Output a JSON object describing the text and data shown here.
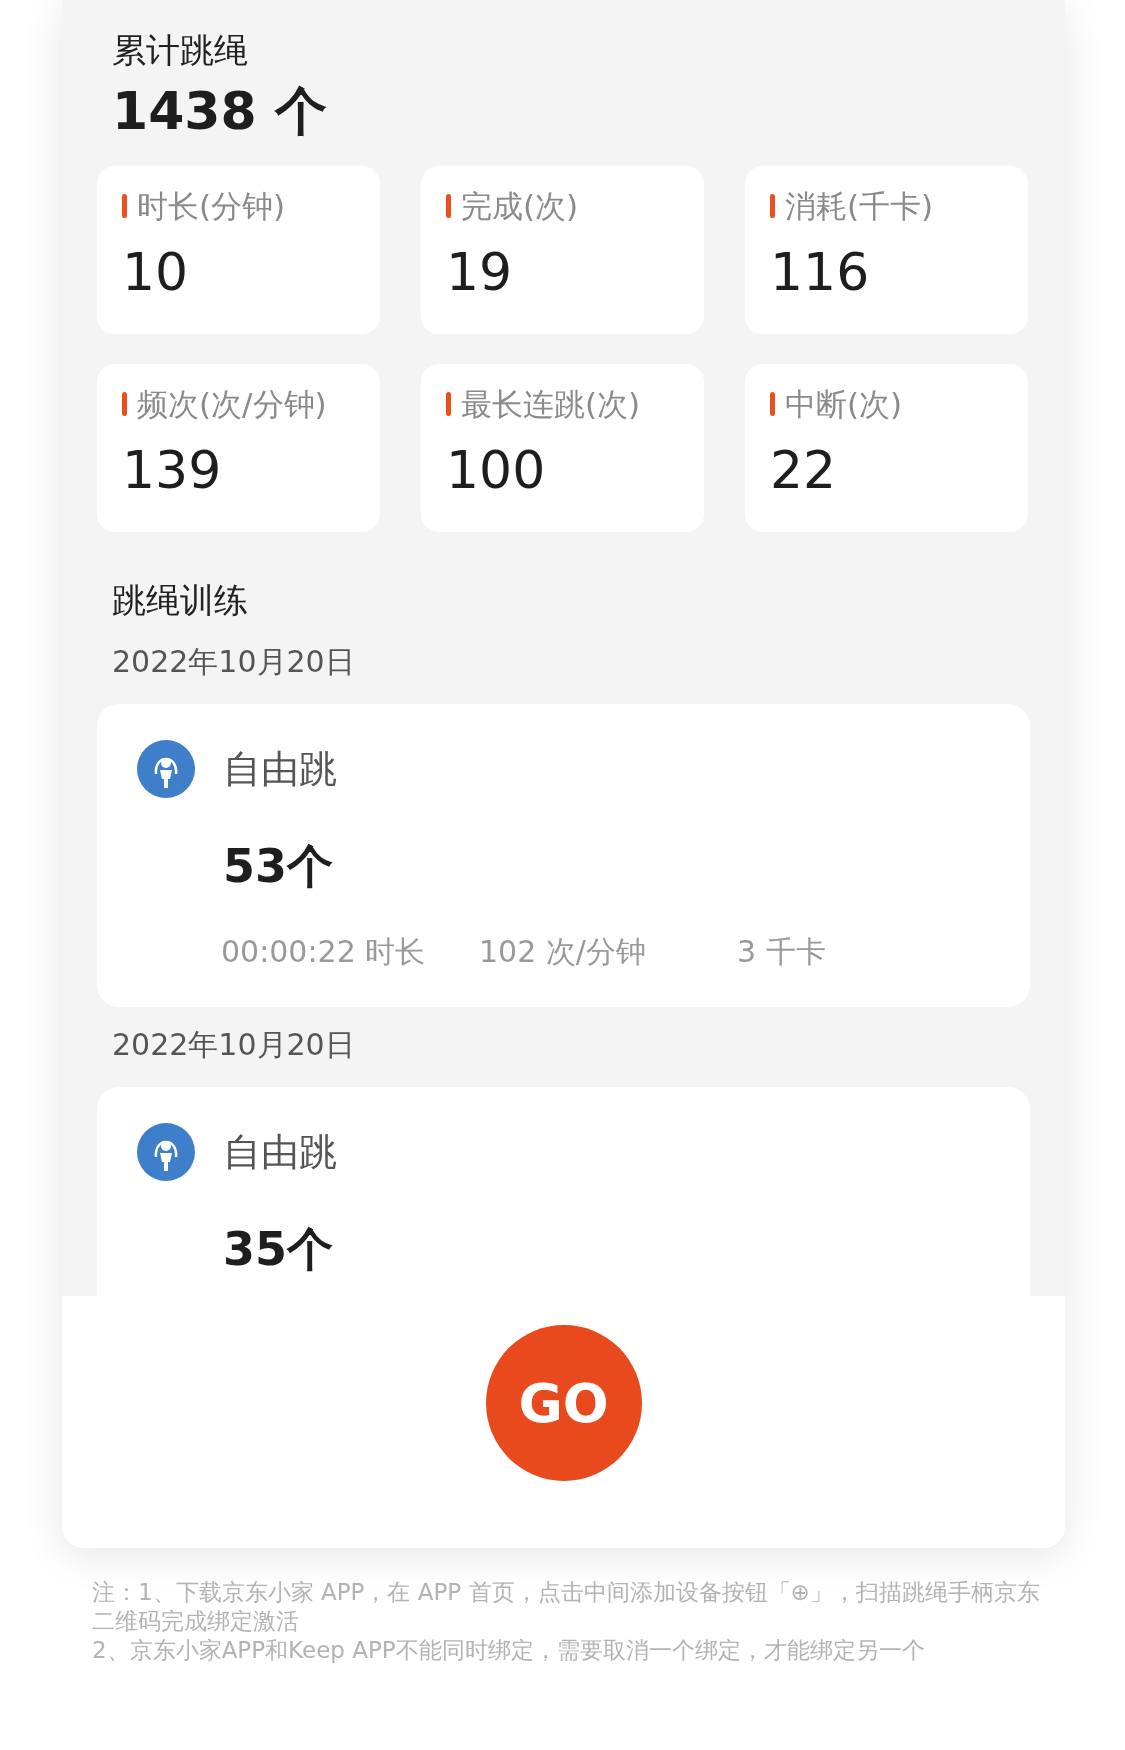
{
  "summary": {
    "title": "累计跳绳",
    "total": "1438 个"
  },
  "stats": [
    {
      "label": "时长(分钟)",
      "value": "10"
    },
    {
      "label": "完成(次)",
      "value": "19"
    },
    {
      "label": "消耗(千卡)",
      "value": "116"
    },
    {
      "label": "频次(次/分钟)",
      "value": "139"
    },
    {
      "label": "最长连跳(次)",
      "value": "100"
    },
    {
      "label": "中断(次)",
      "value": "22"
    }
  ],
  "training": {
    "title": "跳绳训练",
    "records": [
      {
        "date": "2022年10月20日",
        "name": "自由跳",
        "count": "53个",
        "details": [
          "00:00:22 时长",
          "102 次/分钟",
          "3 千卡"
        ]
      },
      {
        "date": "2022年10月20日",
        "name": "自由跳",
        "count": "35个"
      }
    ]
  },
  "go_button": "GO",
  "notes": [
    "注：1、下载京东小家 APP，在 APP 首页，点击中间添加设备按钮「⊕」，扫描跳绳手柄京东二维码完成绑定激活",
    "2、京东小家APP和Keep APP不能同时绑定，需要取消一个绑定，才能绑定另一个"
  ]
}
